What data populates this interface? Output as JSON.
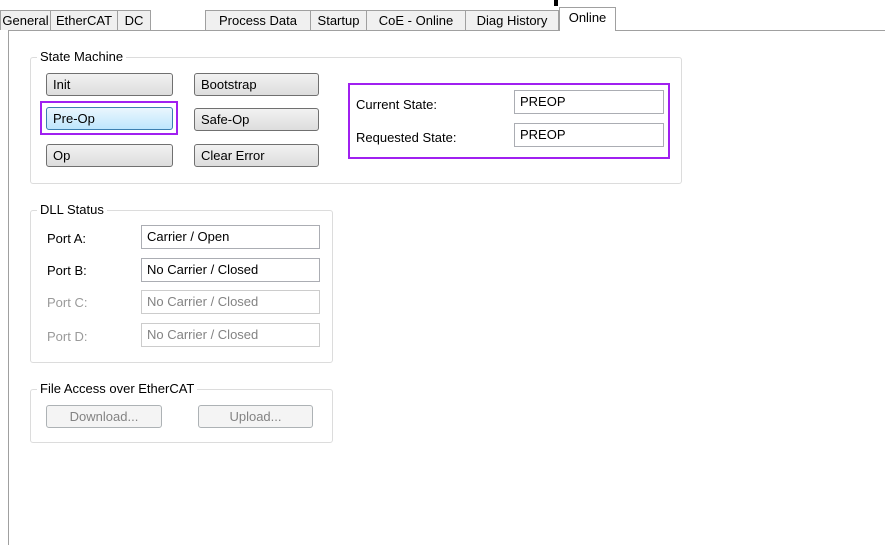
{
  "tabs": [
    "General",
    "EtherCAT",
    "DC",
    "Process Data",
    "Startup",
    "CoE - Online",
    "Diag History",
    "Online"
  ],
  "active_tab": "Online",
  "state_machine": {
    "title": "State Machine",
    "buttons": {
      "init": "Init",
      "bootstrap": "Bootstrap",
      "preop": "Pre-Op",
      "safeop": "Safe-Op",
      "op": "Op",
      "clear_error": "Clear Error"
    },
    "current_state_label": "Current State:",
    "current_state_value": "PREOP",
    "requested_state_label": "Requested State:",
    "requested_state_value": "PREOP"
  },
  "dll_status": {
    "title": "DLL Status",
    "ports": [
      {
        "label": "Port A:",
        "value": "Carrier / Open"
      },
      {
        "label": "Port B:",
        "value": "No Carrier / Closed"
      },
      {
        "label": "Port C:",
        "value": "No Carrier / Closed"
      },
      {
        "label": "Port D:",
        "value": "No Carrier / Closed"
      }
    ]
  },
  "file_access": {
    "title": "File Access over EtherCAT",
    "download_label": "Download...",
    "upload_label": "Upload..."
  },
  "colors": {
    "highlight": "#a020f0",
    "focused_button": "#bee6fd"
  }
}
